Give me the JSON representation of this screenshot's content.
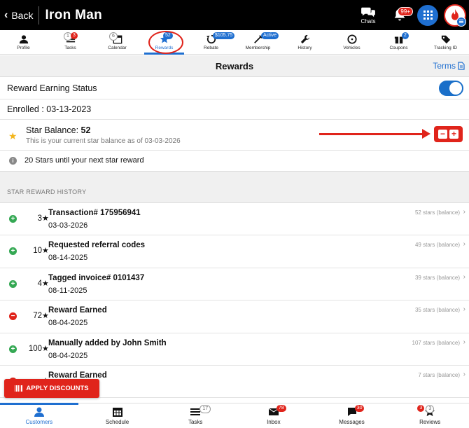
{
  "topbar": {
    "back_label": "Back",
    "title": "Iron Man",
    "chats_label": "Chats",
    "notification_badge": "99+"
  },
  "icon_nav": [
    {
      "label": "Profile",
      "icon": "person-icon",
      "badge": ""
    },
    {
      "label": "Tasks",
      "icon": "tasks-icon",
      "badge": "3",
      "badge2": "1"
    },
    {
      "label": "Calendar",
      "icon": "calendar-icon",
      "badge": "6"
    },
    {
      "label": "Rewards",
      "icon": "star-icon",
      "badge": "52",
      "active": true
    },
    {
      "label": "Rebate",
      "icon": "rebate-icon",
      "badge": "$105.75"
    },
    {
      "label": "Membership",
      "icon": "membership-icon",
      "badge": "Active"
    },
    {
      "label": "History",
      "icon": "wrench-icon",
      "badge": ""
    },
    {
      "label": "Vehicles",
      "icon": "steering-wheel-icon",
      "badge": ""
    },
    {
      "label": "Coupons",
      "icon": "gift-icon",
      "badge": "2"
    },
    {
      "label": "Tracking ID",
      "icon": "tag-icon",
      "badge": ""
    }
  ],
  "rewards": {
    "title": "Rewards",
    "terms_label": "Terms",
    "earning_status_label": "Reward Earning Status",
    "earning_enabled": true,
    "enrolled_text": "Enrolled : 03-13-2023",
    "star_balance_label": "Star Balance:",
    "star_balance_value": "52",
    "star_balance_sub": "This is your current star balance as of 03-03-2026",
    "next_reward_text": "20 Stars until your next star reward",
    "minus_label": "−",
    "plus_label": "+"
  },
  "history": {
    "header": "STAR REWARD HISTORY",
    "items": [
      {
        "sign": "plus",
        "amount": "3",
        "title": "Transaction# 175956941",
        "date": "03-03-2026",
        "balance": "52 stars (balance)"
      },
      {
        "sign": "plus",
        "amount": "10",
        "title": "Requested referral codes",
        "date": "08-14-2025",
        "balance": "49 stars (balance)"
      },
      {
        "sign": "plus",
        "amount": "4",
        "title": "Tagged invoice# 0101437",
        "date": "08-11-2025",
        "balance": "39 stars (balance)"
      },
      {
        "sign": "minus",
        "amount": "72",
        "title": "Reward Earned",
        "date": "08-04-2025",
        "balance": "35 stars (balance)"
      },
      {
        "sign": "plus",
        "amount": "100",
        "title": "Manually added by John Smith",
        "date": "08-04-2025",
        "balance": "107 stars (balance)"
      },
      {
        "sign": "minus",
        "amount": "",
        "title": "Reward Earned",
        "date": "",
        "balance": "7 stars (balance)"
      }
    ]
  },
  "apply_discounts_label": "APPLY DISCOUNTS",
  "bottom_tabs": [
    {
      "label": "Customers",
      "icon": "person-icon",
      "badge": "",
      "active": true
    },
    {
      "label": "Schedule",
      "icon": "calendar-icon",
      "badge": ""
    },
    {
      "label": "Tasks",
      "icon": "tasks-icon",
      "badge": "17"
    },
    {
      "label": "Inbox",
      "icon": "envelope-icon",
      "badge": "78"
    },
    {
      "label": "Messages",
      "icon": "chat-icon",
      "badge": "30"
    },
    {
      "label": "Reviews",
      "icon": "star-icon",
      "badge": "3",
      "badge2": "3"
    }
  ],
  "colors": {
    "accent": "#1f6fd0",
    "alert": "#e0241b",
    "positive": "#34a853",
    "star": "#f3b51b"
  }
}
